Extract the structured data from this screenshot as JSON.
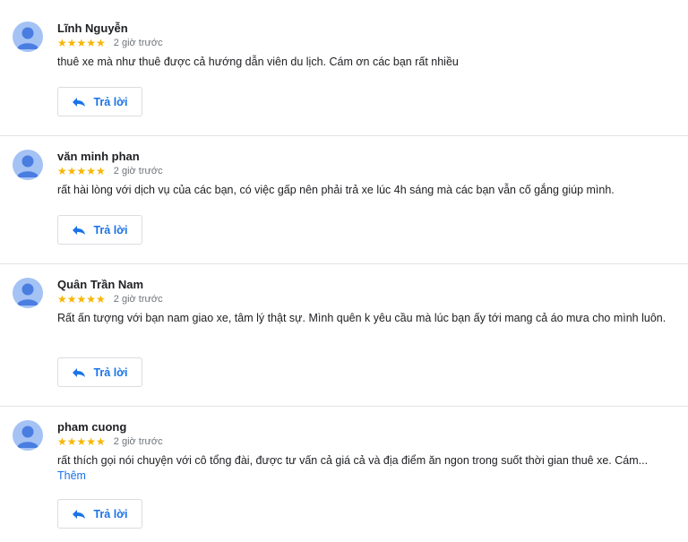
{
  "reviews": [
    {
      "name": "Lĩnh Nguyễn",
      "stars": "★★★★★",
      "rating": 5,
      "time": "2 giờ trước",
      "text": "thuê xe mà như thuê được cả hướng dẫn viên du lịch. Cám ơn các bạn rất nhiều",
      "more": "",
      "reply_label": "Trả lời"
    },
    {
      "name": "văn minh phan",
      "stars": "★★★★★",
      "rating": 5,
      "time": "2 giờ trước",
      "text": "rất hài lòng với dịch vụ của các bạn, có việc gấp nên phải trả xe lúc 4h sáng mà các bạn vẫn cố gắng giúp mình.",
      "more": "",
      "reply_label": "Trả lời"
    },
    {
      "name": "Quân Trần Nam",
      "stars": "★★★★★",
      "rating": 5,
      "time": "2 giờ trước",
      "text": "Rất ấn tượng với bạn nam giao xe, tâm lý thật sự. Mình quên k yêu cầu mà lúc bạn ấy tới mang cả áo mưa cho mình luôn.",
      "more": "",
      "reply_label": "Trả lời"
    },
    {
      "name": "pham cuong",
      "stars": "★★★★★",
      "rating": 5,
      "time": "2 giờ trước",
      "text": "rất thích gọi nói chuyện với cô tổng đài, được tư vấn cả giá cả và địa điểm ăn ngon trong suốt thời gian thuê xe. Cám...",
      "more": "Thêm",
      "reply_label": "Trả lời"
    }
  ],
  "colors": {
    "star": "#f7b500",
    "accent": "#1a73e8",
    "avatar": "#a4c2f4",
    "divider": "#e4e4e4"
  },
  "icons": {
    "avatar": "person-avatar-icon",
    "reply": "reply-arrow-icon"
  }
}
